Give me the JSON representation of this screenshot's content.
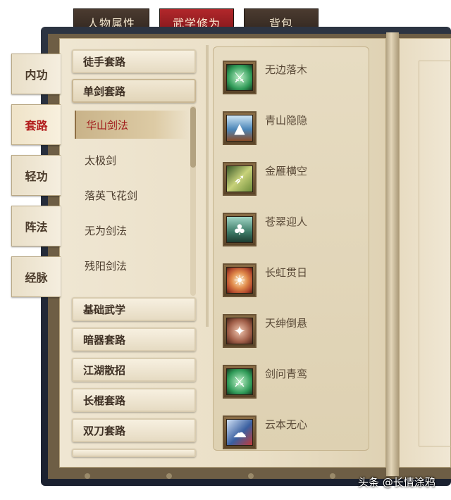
{
  "top_tabs": [
    {
      "label": "人物属性",
      "active": false
    },
    {
      "label": "武学修为",
      "active": true
    },
    {
      "label": "背包",
      "active": false
    }
  ],
  "side_tabs": [
    {
      "label": "内功",
      "active": false
    },
    {
      "label": "套路",
      "active": true
    },
    {
      "label": "轻功",
      "active": false
    },
    {
      "label": "阵法",
      "active": false
    },
    {
      "label": "经脉",
      "active": false
    }
  ],
  "categories_top": [
    "徒手套路",
    "单剑套路"
  ],
  "sub_items": [
    {
      "label": "华山剑法",
      "active": true
    },
    {
      "label": "太极剑",
      "active": false
    },
    {
      "label": "落英飞花剑",
      "active": false
    },
    {
      "label": "无为剑法",
      "active": false
    },
    {
      "label": "残阳剑法",
      "active": false
    }
  ],
  "categories_bottom": [
    "基础武学",
    "暗器套路",
    "江湖散招",
    "长棍套路",
    "双刀套路"
  ],
  "skills": [
    {
      "name": "无边落木",
      "icon": "sword-green-orb-icon",
      "color": "#2f9a57"
    },
    {
      "name": "青山隐隐",
      "icon": "sword-mountain-icon",
      "color": "#4b86b8"
    },
    {
      "name": "金雁横空",
      "icon": "flying-goose-icon",
      "color": "#6e8c3a"
    },
    {
      "name": "苍翠迎人",
      "icon": "pine-tree-icon",
      "color": "#3c7a66"
    },
    {
      "name": "长虹贯日",
      "icon": "sun-rainbow-icon",
      "color": "#b34a2e"
    },
    {
      "name": "天绅倒悬",
      "icon": "hanging-sword-icon",
      "color": "#a2604a"
    },
    {
      "name": "剑问青鸾",
      "icon": "sword-green-orb-icon",
      "color": "#2f9a57"
    },
    {
      "name": "云本无心",
      "icon": "cloud-sword-icon",
      "color": "#3a5fa0"
    }
  ],
  "watermark": "头条 @长情涂鸦"
}
